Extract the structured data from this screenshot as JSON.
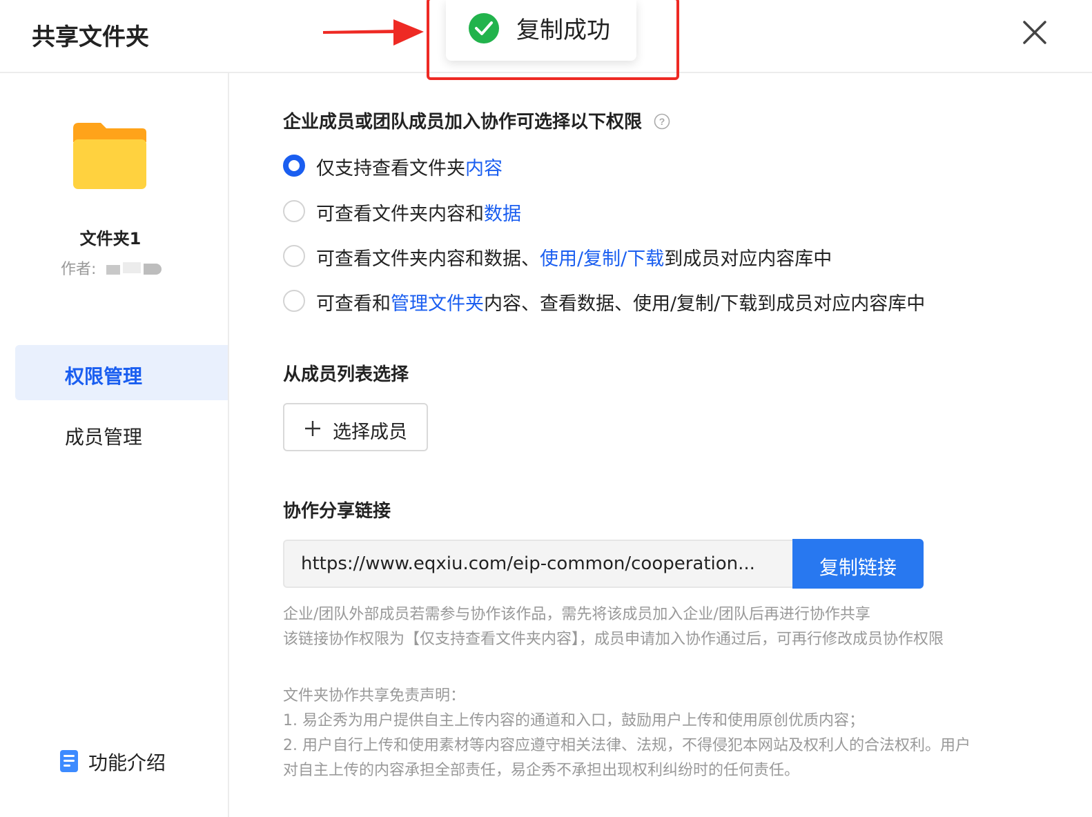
{
  "header": {
    "title": "共享文件夹"
  },
  "toast": {
    "text": "复制成功"
  },
  "sidebar": {
    "folder_name": "文件夹1",
    "author_label": "作者:",
    "nav": [
      {
        "label": "权限管理",
        "active": true
      },
      {
        "label": "成员管理",
        "active": false
      }
    ],
    "function_intro": "功能介绍"
  },
  "permissions": {
    "title": "企业成员或团队成员加入协作可选择以下权限",
    "options": [
      {
        "parts": [
          "仅支持查看文件夹",
          "内容",
          ""
        ],
        "selected": true
      },
      {
        "parts": [
          "可查看文件夹内容和",
          "数据",
          ""
        ],
        "selected": false
      },
      {
        "parts": [
          "可查看文件夹内容和数据、",
          "使用/复制/下载",
          "到成员对应内容库中"
        ],
        "selected": false
      },
      {
        "parts": [
          "可查看和",
          "管理文件夹",
          "内容、查看数据、使用/复制/下载到成员对应内容库中"
        ],
        "selected": false
      }
    ]
  },
  "members": {
    "title": "从成员列表选择",
    "select_button": "选择成员"
  },
  "share": {
    "title": "协作分享链接",
    "link": "https://www.eqxiu.com/eip-common/cooperation...",
    "copy_button": "复制链接",
    "notes": [
      "企业/团队外部成员若需参与协作该作品，需先将该成员加入企业/团队后再进行协作共享",
      "该链接协作权限为【仅支持查看文件夹内容】，成员申请加入协作通过后，可再行修改成员协作权限"
    ]
  },
  "disclaimer": {
    "lines": [
      "文件夹协作共享免责声明：",
      "1. 易企秀为用户提供自主上传内容的通道和入口，鼓励用户上传和使用原创优质内容；",
      "2. 用户自行上传和使用素材等内容应遵守相关法律、法规，不得侵犯本网站及权利人的合法权利。用户",
      "对自主上传的内容承担全部责任，易企秀不承担出现权利纠纷时的任何责任。"
    ]
  },
  "colors": {
    "accent": "#1a5ef0",
    "button": "#2878f0",
    "toast_check": "#22b34c",
    "highlight_border": "#ee2a24",
    "folder": "#ffd23f"
  },
  "icons": [
    "close-icon",
    "check-circle-icon",
    "arrow-annotation",
    "folder-icon",
    "help-icon",
    "plus-icon",
    "document-icon"
  ]
}
